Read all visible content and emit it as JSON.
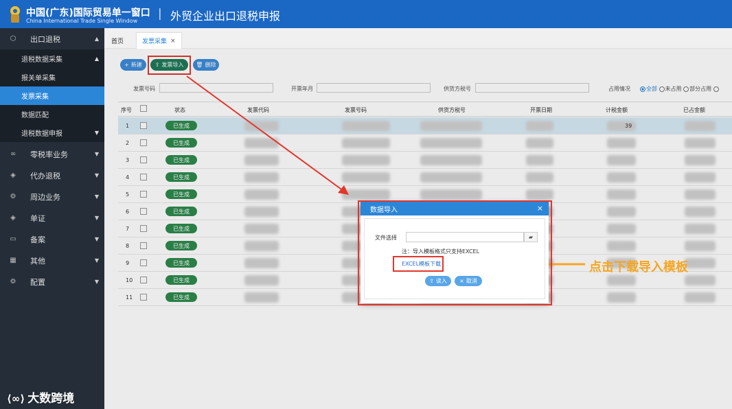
{
  "header": {
    "brand_cn": "中国(广东)国际贸易单一窗口",
    "brand_en": "China International Trade Single Window",
    "divider": "|",
    "app_title": "外贸企业出口退税申报"
  },
  "sidebar": {
    "items": [
      {
        "label": "出口退税",
        "icon": "cube-icon",
        "arrow": "▲"
      },
      {
        "label": "零税率业务",
        "icon": "link-icon",
        "arrow": "▼"
      },
      {
        "label": "代办退税",
        "icon": "stack-icon",
        "arrow": "▼"
      },
      {
        "label": "周边业务",
        "icon": "gear-icon",
        "arrow": "▼"
      },
      {
        "label": "单证",
        "icon": "stack-icon",
        "arrow": "▼"
      },
      {
        "label": "备案",
        "icon": "book-icon",
        "arrow": "▼"
      },
      {
        "label": "其他",
        "icon": "grid-icon",
        "arrow": "▼"
      },
      {
        "label": "配置",
        "icon": "gear-icon",
        "arrow": "▼"
      }
    ],
    "sub_items": [
      {
        "label": "退税数据采集",
        "arrow": "▲"
      },
      {
        "label": "报关单采集",
        "arrow": ""
      },
      {
        "label": "发票采集",
        "arrow": ""
      },
      {
        "label": "数据匹配",
        "arrow": ""
      },
      {
        "label": "退税数据申报",
        "arrow": "▼"
      }
    ]
  },
  "tabs": [
    {
      "label": "首页"
    },
    {
      "label": "发票采集",
      "close": "×"
    }
  ],
  "toolbar": {
    "add_label": "新建",
    "import_label": "发票导入",
    "delete_label": "删除"
  },
  "search": {
    "invoice_no_label": "发票号码",
    "year_month_label": "开票年月",
    "supplier_tax_label": "供货方税号",
    "usage_label": "占用情况",
    "usage_options": [
      "全部",
      "未占用",
      "部分占用"
    ],
    "usage_selected": "全部"
  },
  "table": {
    "columns": [
      "序号",
      "状态",
      "发票代码",
      "发票号码",
      "供货方税号",
      "开票日期",
      "计税金额",
      "已占金额"
    ],
    "rows": [
      {
        "num": "1",
        "status": "已生成",
        "amount_fragment": "39"
      },
      {
        "num": "2",
        "status": "已生成",
        "amount_fragment": ""
      },
      {
        "num": "3",
        "status": "已生成",
        "amount_fragment": ""
      },
      {
        "num": "4",
        "status": "已生成",
        "amount_fragment": ""
      },
      {
        "num": "5",
        "status": "已生成",
        "amount_fragment": ""
      },
      {
        "num": "6",
        "status": "已生成",
        "amount_fragment": ""
      },
      {
        "num": "7",
        "status": "已生成",
        "amount_fragment": ""
      },
      {
        "num": "8",
        "status": "已生成",
        "amount_fragment": ""
      },
      {
        "num": "9",
        "status": "已生成",
        "amount_fragment": ""
      },
      {
        "num": "10",
        "status": "已生成",
        "amount_fragment": ""
      },
      {
        "num": "11",
        "status": "已生成",
        "amount_fragment": ""
      }
    ]
  },
  "modal": {
    "title": "数据导入",
    "close": "×",
    "file_label": "文件选择",
    "note": "注：导入模板格式只支持EXCEL",
    "template_link": "EXCEL模板下载",
    "read_label": "读入",
    "cancel_label": "取消"
  },
  "annotation": {
    "callout": "点击下载导入模板"
  },
  "watermark": "大数跨境",
  "colors": {
    "header": "#1b67c4",
    "sidebar": "#252e38",
    "active_item": "#2b86d8",
    "status_badge": "#2e8a4e",
    "highlight": "#e2362b",
    "callout": "#f5a623"
  }
}
